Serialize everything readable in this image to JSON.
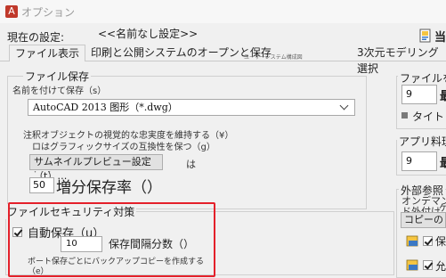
{
  "window": {
    "title": "オプション"
  },
  "profile": {
    "label": "現在の設定:",
    "value": "<<名前なし設定>>",
    "drawing_label": "当"
  },
  "tabs": [
    {
      "label": "ファイル表示",
      "active": true
    },
    {
      "label": "印刷と公開システムのオープンと保存"
    },
    {
      "label": "ユーザーシステム構成図"
    },
    {
      "label": "3次元モデリング選択"
    }
  ],
  "file_save": {
    "group_label": "ファイル保存",
    "save_as_label": "名前を付けて保存（s）",
    "format_value": "AutoCAD 2013 图形（*.dwg）",
    "annotative_line1": "注釈オブジェクトの視覚的な忠実度を維持する（¥）",
    "annotative_line2": "ロはグラフィックサイズの互換性を保つ（g）",
    "thumbnail_button": "サムネイルプレビュー設定（t）…",
    "thumbnail_suffix": "は",
    "thumb_dots": "・・・",
    "incremental_value": "50",
    "incremental_label": "増分保存率（）"
  },
  "right_panel": {
    "file_open_label": "ファイルを開",
    "recent_value": "9",
    "recent_label": "最",
    "title_label": "タイト",
    "app_menu_label": "アプリ料理",
    "app_value": "9",
    "app_label": "最",
    "xref_label": "外部参照",
    "ondemand_line1": "オンデマン",
    "ondemand_line2": "ド外付け",
    "ondemand_extra": "ケ",
    "copy_button": "コピーの楔",
    "check1_label": "保",
    "check2_label": "允"
  },
  "security": {
    "group_label": "ファイルセキュリティ対策",
    "autosave_label": "自動保存（u）",
    "autosave_checked": true,
    "interval_value": "10",
    "interval_label": "保存間隔分数（）",
    "backup_label": "ボート保存ごとにバックアップコピーを作成する（e）"
  },
  "colors": {
    "highlight": "#e4202a",
    "background": "#f0f0f0"
  }
}
